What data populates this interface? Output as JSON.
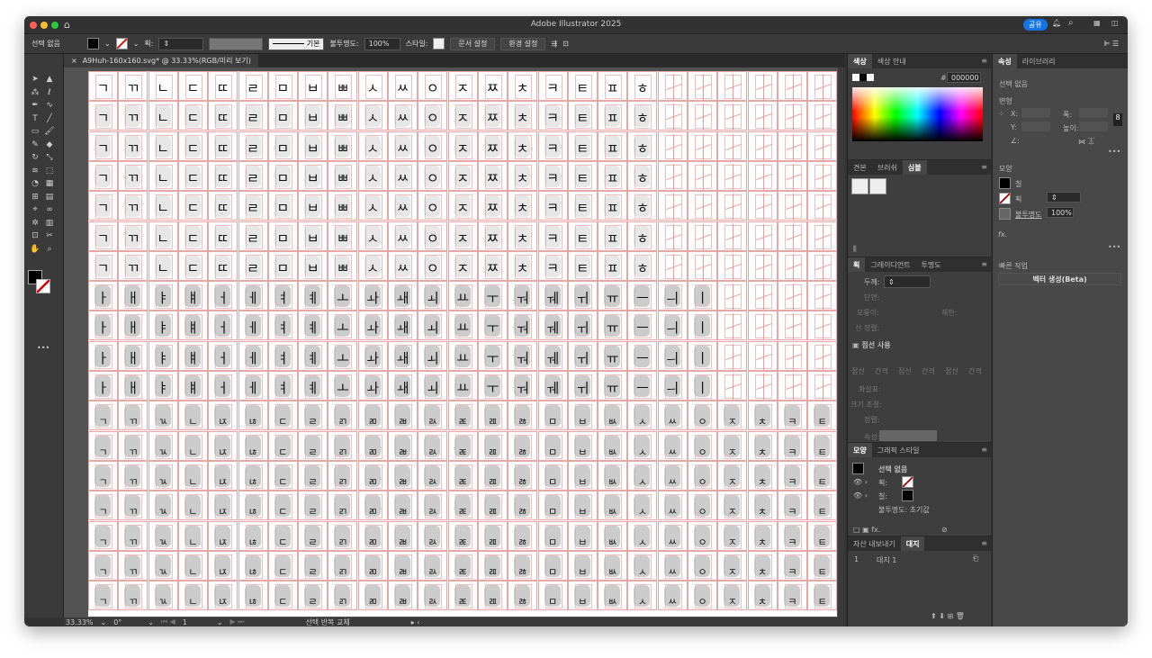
{
  "app": {
    "title": "Adobe Illustrator 2025",
    "share": "공유"
  },
  "control": {
    "selection": "선택 없음",
    "stroke_label": "획:",
    "brush": "기본",
    "opacity_label": "불투명도:",
    "opacity": "100%",
    "style_label": "스타일:",
    "doc_setup": "문서 설정",
    "prefs": "환경 설정"
  },
  "doc": {
    "tab": "A9Huh-160x160.svg* @ 33.33%(RGB/미리 보기)"
  },
  "canvas": {
    "initials": [
      "ㄱ",
      "ㄲ",
      "ㄴ",
      "ㄷ",
      "ㄸ",
      "ㄹ",
      "ㅁ",
      "ㅂ",
      "ㅃ",
      "ㅅ",
      "ㅆ",
      "ㅇ",
      "ㅈ",
      "ㅉ",
      "ㅊ",
      "ㅋ",
      "ㅌ",
      "ㅍ",
      "ㅎ"
    ],
    "vowels": [
      "ㅏ",
      "ㅐ",
      "ㅑ",
      "ㅒ",
      "ㅓ",
      "ㅔ",
      "ㅕ",
      "ㅖ",
      "ㅗ",
      "ㅘ",
      "ㅙ",
      "ㅚ",
      "ㅛ",
      "ㅜ",
      "ㅝ",
      "ㅞ",
      "ㅟ",
      "ㅠ",
      "ㅡ",
      "ㅢ",
      "ㅣ"
    ],
    "finals": [
      "ㄱ",
      "ㄲ",
      "ㄳ",
      "ㄴ",
      "ㄵ",
      "ㄶ",
      "ㄷ",
      "ㄹ",
      "ㄺ",
      "ㄻ",
      "ㄼ",
      "ㄽ",
      "ㄾ",
      "ㄿ",
      "ㅀ",
      "ㅁ",
      "ㅂ",
      "ㅄ",
      "ㅅ",
      "ㅆ",
      "ㅇ",
      "ㅈ",
      "ㅊ",
      "ㅋ",
      "ㅌ"
    ]
  },
  "status": {
    "zoom": "33.33%",
    "rotation": "0°",
    "artboard": "1",
    "action": "선택 반복 교체"
  },
  "color_panel": {
    "tabs": [
      "색상",
      "색상 안내"
    ],
    "hex": "000000"
  },
  "swatch_panel": {
    "tabs": [
      "견본",
      "브러쉬",
      "심볼"
    ]
  },
  "stroke_panel": {
    "tabs": [
      "획",
      "그레이디언트",
      "투명도"
    ],
    "weight": "두께:",
    "cap": "단면:",
    "corner": "모퉁이:",
    "limit": "제한:",
    "align": "선 정렬:",
    "dashed": "점선 사용",
    "dash_labels": [
      "점선",
      "간격",
      "점선",
      "간격",
      "점선",
      "간격"
    ],
    "arrow": "화살표:",
    "scale": "크기 조절:",
    "arrow_align": "정렬:",
    "profile": "속성:"
  },
  "appearance_panel": {
    "tabs": [
      "모양",
      "그래픽 스타일"
    ],
    "title": "선택 없음",
    "stroke": "획:",
    "fill": "칠:",
    "opacity": "불투명도: 초기값"
  },
  "artboards_panel": {
    "tabs": [
      "자산 내보내기",
      "대지"
    ],
    "rows": [
      {
        "num": "1",
        "name": "대지 1"
      }
    ]
  },
  "properties": {
    "tabs": [
      "속성",
      "라이브러리"
    ],
    "selection": "선택 없음",
    "transform": "변형",
    "x": "X:",
    "y": "Y:",
    "w": "폭:",
    "h": "높이:",
    "appearance": "모양",
    "fill": "칠",
    "stroke": "획",
    "opacity_label": "불투명도",
    "opacity": "100%",
    "quick_actions": "빠른 작업",
    "vectorize": "벡터 생성(Beta)"
  },
  "colors": {
    "accent": "#1473e6",
    "guide": "#e7a7a7"
  }
}
